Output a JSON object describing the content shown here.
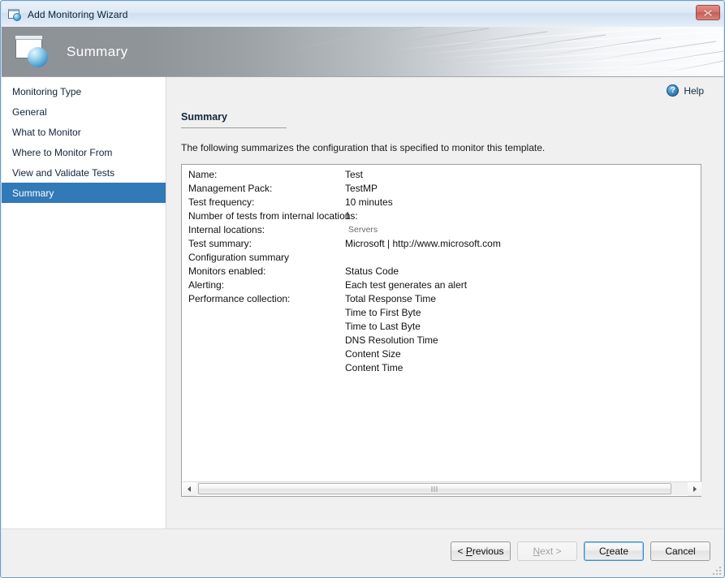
{
  "window": {
    "title": "Add Monitoring Wizard",
    "icon": "wizard-window-icon",
    "close_label": "x"
  },
  "banner": {
    "title": "Summary",
    "icon": "wizard-page-sphere-icon"
  },
  "sidebar": {
    "items": [
      {
        "label": "Monitoring Type",
        "selected": false
      },
      {
        "label": "General",
        "selected": false
      },
      {
        "label": "What to Monitor",
        "selected": false
      },
      {
        "label": "Where to Monitor From",
        "selected": false
      },
      {
        "label": "View and Validate Tests",
        "selected": false
      },
      {
        "label": "Summary",
        "selected": true
      }
    ],
    "selected_color": "#3279b7"
  },
  "content": {
    "help": {
      "label": "Help",
      "icon": "help-question-icon",
      "badge": "?"
    },
    "section_title": "Summary",
    "intro": "The following summarizes the configuration that is specified to monitor this template.",
    "summary_rows": [
      {
        "label": "Name:",
        "value": "Test",
        "style": "normal"
      },
      {
        "label": "Management Pack:",
        "value": "TestMP",
        "style": "normal"
      },
      {
        "label": "Test frequency:",
        "value": "10 minutes",
        "style": "normal"
      },
      {
        "label": "Number of tests from internal locations:",
        "value": "1",
        "style": "normal"
      },
      {
        "label": "Internal locations:",
        "value": "Servers",
        "style": "subtle"
      },
      {
        "label": "Test summary:",
        "value": "Microsoft | http://www.microsoft.com",
        "style": "normal"
      },
      {
        "label": "Configuration summary",
        "value": "",
        "style": "heading"
      },
      {
        "label": "Monitors enabled:",
        "value": "Status Code",
        "style": "normal"
      },
      {
        "label": "Alerting:",
        "value": "Each test generates an alert",
        "style": "normal"
      },
      {
        "label": "Performance collection:",
        "value": "Total Response Time",
        "style": "normal"
      },
      {
        "label": "",
        "value": "Time to First Byte",
        "style": "normal"
      },
      {
        "label": "",
        "value": "Time to Last Byte",
        "style": "normal"
      },
      {
        "label": "",
        "value": "DNS Resolution Time",
        "style": "normal"
      },
      {
        "label": "",
        "value": "Content Size",
        "style": "normal"
      },
      {
        "label": "",
        "value": "Content Time",
        "style": "normal"
      }
    ],
    "scrollbar": {
      "left_arrow": "scroll-left-arrow-icon",
      "right_arrow": "scroll-right-arrow-icon"
    }
  },
  "footer": {
    "buttons": [
      {
        "name": "previous",
        "label": "Previous",
        "prefix": "< ",
        "suffix": "",
        "mnemonic": "P",
        "state": "normal"
      },
      {
        "name": "next",
        "label": "Next",
        "prefix": "",
        "suffix": " >",
        "mnemonic": "N",
        "state": "disabled"
      },
      {
        "name": "create",
        "label": "Create",
        "prefix": "",
        "suffix": "",
        "mnemonic": "r",
        "state": "focused"
      },
      {
        "name": "cancel",
        "label": "Cancel",
        "prefix": "",
        "suffix": "",
        "mnemonic": "",
        "state": "normal"
      }
    ]
  }
}
